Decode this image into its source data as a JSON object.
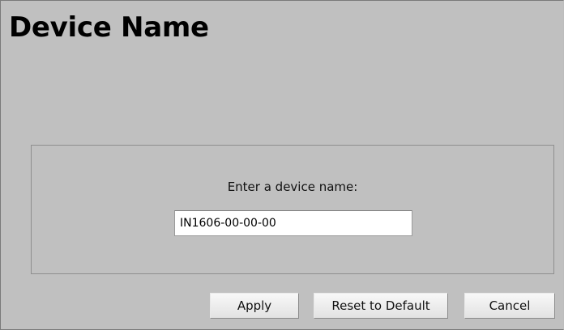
{
  "page": {
    "title": "Device Name"
  },
  "form": {
    "prompt": "Enter a device name:",
    "device_name_value": "IN1606-00-00-00"
  },
  "buttons": {
    "apply_label": "Apply",
    "reset_label": "Reset to Default",
    "cancel_label": "Cancel"
  }
}
